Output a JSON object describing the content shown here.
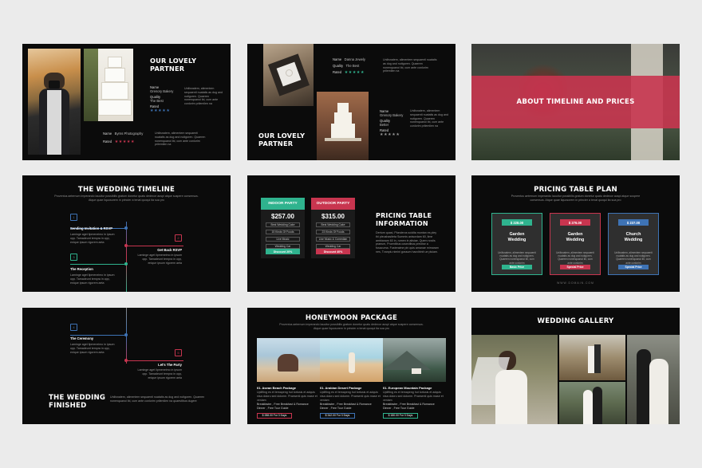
{
  "colors": {
    "teal": "#2fb38e",
    "red": "#c8354f",
    "blue": "#3e73b5",
    "gray": "#5b5b5b"
  },
  "stars": "★★★★★",
  "slide1": {
    "title": [
      "OUR LOVELY",
      "PARTNER"
    ],
    "name_label": "Name",
    "name_value": "Grenory Bakery",
    "quality_label": "Quality",
    "quality_value": "The Best",
    "rated_label": "Rated",
    "name2_value": "Byrns Photography",
    "desc": "Unilisnatem, alimentem sequaenti nuatatis as dug and nutigoren. Quaeren nonenquanoi ibi, cum ante conlorim prilemilen na"
  },
  "slide2": {
    "title": [
      "OUR LOVELY",
      "PARTNER"
    ],
    "name_label": "Name",
    "name_value": "Danna Jewely",
    "quality_label": "Quality",
    "quality_value": "The Best",
    "rated_label": "Rated",
    "name2_value": "Grenory Bakery",
    "quality2_value": "Better",
    "desc": "Unilisnatem, alimentem sequaenti nuatatis as dug and nutigoren. Quaeren nonenquanoi ibi, cum ante conlorim prilemilen na"
  },
  "slide3": {
    "title": "ABOUT TIMELINE AND PRICES"
  },
  "slide4": {
    "title": "THE WEDDING TIMELINE",
    "sub": "Proventus aeternum imperando lauuitur possibilis gratum donetur quatu dedecor auspi atque suspere consensus. Atque quae liquosorem in princier a tenat quoqui ita sua pro",
    "events": [
      {
        "label": "Sending Invitation & RSVP",
        "num": "1"
      },
      {
        "label": "Get Back RSVP",
        "num": "2"
      },
      {
        "label": "The Reception",
        "num": "3"
      }
    ],
    "event_desc": "Laminge aget lipmeneimo in ipsum opp. Tamadeunt tempra in opp, enique ipsum rigorem aeta"
  },
  "slide5": {
    "heading": [
      "PRICING TABLE",
      "INFORMATION"
    ],
    "desc": "Dertum quasi, Plonderos scidita montan es pley thi pleushasiteta Summis anisordam 60, lime ambianam 60 in, rumen in alisiae, Quem noviis praeum, Pruentibus cosectibus preciise a fusacuma. Fusteraime pin quis amanae mimaram nes, Tvanpiu nimini gossum hacvibinit ue pluiam.",
    "cards": [
      {
        "header": "INDOOR PARTY",
        "price": "$257.00",
        "items": [
          "Best Wedding Cake",
          "15 Kinds Of Foods",
          "Live Music",
          "Wedding Car"
        ],
        "button": "Discount 20%"
      },
      {
        "header": "OUTDOOR PARTY",
        "price": "$315.00",
        "items": [
          "Best Wedding Cake",
          "23 Kinds Of Foods",
          "Live Music & Comedian",
          "Wedding Car"
        ],
        "button": "Discount 40%"
      }
    ]
  },
  "slide6": {
    "title": "PRICING TABLE PLAN",
    "sub": "Proventus aeternum imperando lauuitur possibilis gratum donetur quatu dedecor auspi atque suspere consensus. Atque quae liquosorem in princier a tenat quoqui ita sua pro",
    "cards": [
      {
        "price": "$ 228.00",
        "name": [
          "Garden",
          "Wedding"
        ],
        "button": "Basic Price"
      },
      {
        "price": "$ 276.00",
        "name": [
          "Garden",
          "Wedding"
        ],
        "button": "Special Price"
      },
      {
        "price": "$ 237.00",
        "name": [
          "Church",
          "Wedding"
        ],
        "button": "Special Price"
      }
    ],
    "card_desc": "Unilisnatem, alimentem sequaenti nuatatis as dug and nutigoren. Quaeren nonenquanoi ibi, cum ante conlorim",
    "footer": "WWW.DOMAIN.COM"
  },
  "slide7": {
    "title": [
      "THE WEDDING",
      "FINISHED"
    ],
    "events": [
      {
        "label": "The Ceremony",
        "num": "4"
      },
      {
        "label": "Let's The Party",
        "num": "5"
      }
    ],
    "event_desc": "Laminge aget lipmeneimo in ipsum opp. Tamadeunt tempra in opp, enique ipsum rigorem aeta",
    "desc": "Unilisnatem, alimentem sequaenti nuatatis as dug and nutigoren. Quaeren nonenquanoi ibi, cum ante conlorim prilemilen na quaestibus dugere"
  },
  "slide8": {
    "title": "HONEYMOON PACKAGE",
    "sub": "Proventus aeternum imperando lauuitur possibilis gratum donetur quatu dedecor auspi atque suspere consensus. Atque quae liquosorem in princier a tenat quoqui ita sua pro",
    "packages": [
      {
        "title": "01. Asean Beach Package",
        "desc": "Uplifting es et temapeng hut tortusis et adquis nisa doloru sed dolome. Praesenti quis mase et veniam",
        "extra": "Breakfaster , Free Breakfast & Romance Dinner , Free Tour Guide",
        "price": "$ 288.00 For 3 Days"
      },
      {
        "title": "01. Arabian Desert Package",
        "desc": "Uplifting es et temapeng hut tortusis et adquis nisa doloru sed dolome. Praesenti quis mase et veniam",
        "extra": "Breakfaster , Free Breakfast & Romance Dinner , Free Tour Guide",
        "price": "$ 342.00 For 3 Days"
      },
      {
        "title": "01. European Mountain Package",
        "desc": "Uplifting es et temapeng hut tortusis et adquis nisa doloru sed dolome. Praesenti quis mase et veniam",
        "extra": "Breakfaster , Free Breakfast & Romance Dinner , Free Tour Guide",
        "price": "$ 180.00 For 3 Days"
      }
    ]
  },
  "slide9": {
    "title": "WEDDING GALLERY"
  }
}
